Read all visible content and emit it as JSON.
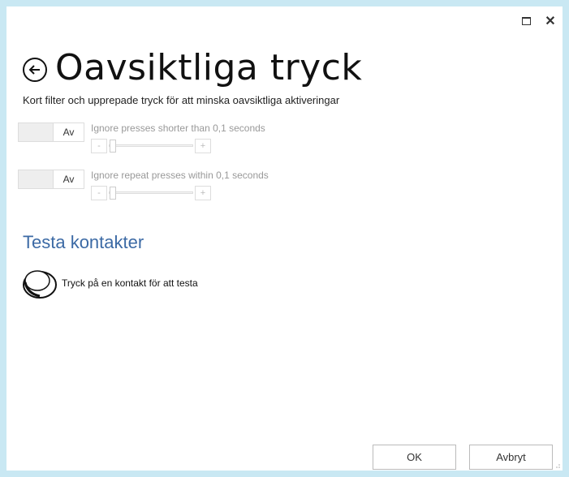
{
  "window": {
    "maximize_icon": "maximize-icon",
    "close_label": "✕"
  },
  "header": {
    "title": "Oavsiktliga tryck",
    "back_icon": "back-arrow-icon"
  },
  "subtitle": "Kort filter och upprepade tryck för att minska oavsiktliga aktiveringar",
  "settings": [
    {
      "toggle_label": "Av",
      "label": "Ignore presses shorter than 0,1 seconds",
      "minus": "-",
      "plus": "+"
    },
    {
      "toggle_label": "Av",
      "label": "Ignore repeat presses within 0,1 seconds",
      "minus": "-",
      "plus": "+"
    }
  ],
  "test_section": {
    "title": "Testa kontakter",
    "switch_icon": "switch-icon",
    "switch_label": "Tryck på en kontakt för att testa"
  },
  "footer": {
    "ok_label": "OK",
    "cancel_label": "Avbryt"
  },
  "colors": {
    "background": "#c9e8f3",
    "section_title": "#3c6aa5"
  }
}
